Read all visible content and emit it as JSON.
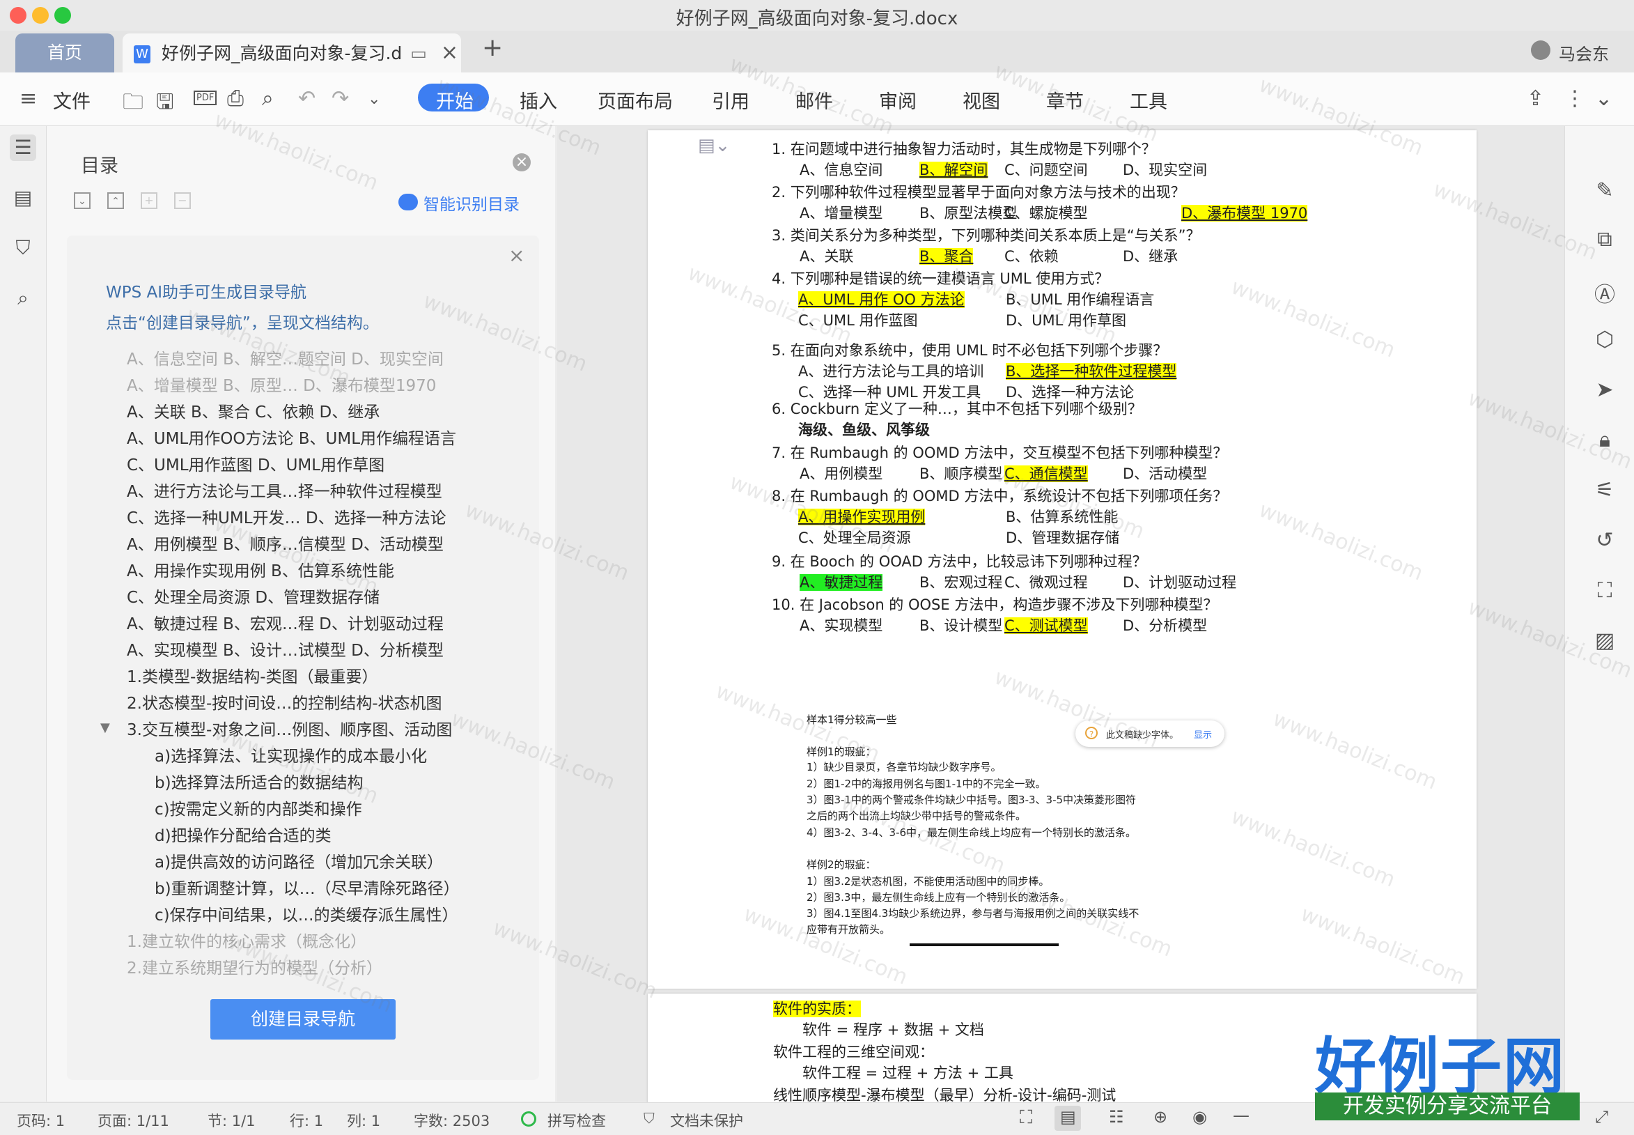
{
  "window": {
    "title": "好例子网_高级面向对象-复习.docx"
  },
  "tabs": {
    "home": "首页",
    "doc": "好例子网_高级面向对象-复习.d",
    "add": "+",
    "user": "马会东"
  },
  "ribbon": {
    "file": "文件",
    "menus": [
      "开始",
      "插入",
      "页面布局",
      "引用",
      "邮件",
      "审阅",
      "视图",
      "章节",
      "工具"
    ]
  },
  "toc": {
    "title": "目录",
    "smart": "智能识别目录",
    "ai_line1": "WPS AI助手可生成目录导航",
    "ai_line2": "点击“创建目录导航”，呈现文档结构。",
    "items": [
      {
        "text": "A、信息空间  B、解空…题空间  D、现实空间",
        "dim": true,
        "indent": 0
      },
      {
        "text": "A、增量模型  B、原型… D、瀑布模型1970",
        "dim": true,
        "indent": 0
      },
      {
        "text": "A、关联  B、聚合  C、依赖  D、继承",
        "dim": false,
        "indent": 0
      },
      {
        "text": "A、UML用作OO方法论  B、UML用作编程语言",
        "dim": false,
        "indent": 0
      },
      {
        "text": "C、UML用作蓝图    D、UML用作草图",
        "dim": false,
        "indent": 0
      },
      {
        "text": "A、进行方法论与工具…择一种软件过程模型",
        "dim": false,
        "indent": 0
      },
      {
        "text": "C、选择一种UML开发… D、选择一种方法论",
        "dim": false,
        "indent": 0
      },
      {
        "text": "A、用例模型  B、顺序…信模型  D、活动模型",
        "dim": false,
        "indent": 0
      },
      {
        "text": "A、用操作实现用例   B、估算系统性能",
        "dim": false,
        "indent": 0
      },
      {
        "text": "C、处理全局资源    D、管理数据存储",
        "dim": false,
        "indent": 0
      },
      {
        "text": "A、敏捷过程  B、宏观…程  D、计划驱动过程",
        "dim": false,
        "indent": 0
      },
      {
        "text": "A、实现模型  B、设计…试模型  D、分析模型",
        "dim": false,
        "indent": 0
      },
      {
        "text": "1.类模型-数据结构-类图（最重要）",
        "dim": false,
        "indent": 0
      },
      {
        "text": "2.状态模型-按时间设…的控制结构-状态机图",
        "dim": false,
        "indent": 0
      },
      {
        "text": "3.交互模型-对象之间…例图、顺序图、活动图",
        "dim": false,
        "indent": 0
      },
      {
        "text": "a)选择算法、让实现操作的成本最小化",
        "dim": false,
        "indent": 1
      },
      {
        "text": "b)选择算法所适合的数据结构",
        "dim": false,
        "indent": 1
      },
      {
        "text": "c)按需定义新的内部类和操作",
        "dim": false,
        "indent": 1
      },
      {
        "text": "d)把操作分配给合适的类",
        "dim": false,
        "indent": 1
      },
      {
        "text": "a)提供高效的访问路径（增加冗余关联）",
        "dim": false,
        "indent": 1
      },
      {
        "text": "b)重新调整计算，以…（尽早清除死路径）",
        "dim": false,
        "indent": 1
      },
      {
        "text": "c)保存中间结果，以…的类缓存派生属性）",
        "dim": false,
        "indent": 1
      },
      {
        "text": "1.建立软件的核心需求（概念化）",
        "dim": true,
        "indent": 0
      },
      {
        "text": "2.建立系统期望行为的模型（分析）",
        "dim": true,
        "indent": 0
      }
    ],
    "create_button": "创建目录导航"
  },
  "doc": {
    "questions": [
      {
        "q": "1.   在问题域中进行抽象智力活动时，其生成物是下列哪个？",
        "opts": [
          [
            "A、信息空间",
            ""
          ],
          [
            "B、解空间",
            "y"
          ],
          [
            "C、问题空间",
            ""
          ],
          [
            "D、现实空间",
            ""
          ]
        ]
      },
      {
        "q": "2.   下列哪种软件过程模型显著早于面向对象方法与技术的出现？",
        "opts": [
          [
            "A、增量模型",
            ""
          ],
          [
            "B、原型法模型",
            ""
          ],
          [
            "C、螺旋模型",
            ""
          ],
          [
            "D、瀑布模型 1970",
            "y"
          ]
        ]
      },
      {
        "q": "3.   类间关系分为多种类型，下列哪种类间关系本质上是“与关系”？",
        "opts": [
          [
            "A、关联",
            ""
          ],
          [
            "B、聚合",
            "y"
          ],
          [
            "C、依赖",
            ""
          ],
          [
            "D、继承",
            ""
          ]
        ]
      },
      {
        "q": "4.   下列哪种是错误的统一建模语言 UML 使用方式？",
        "opts": [
          [
            "A、UML 用作 OO 方法论",
            "y"
          ],
          [
            "B、UML 用作编程语言",
            ""
          ],
          [
            "C、UML 用作蓝图",
            ""
          ],
          [
            "D、UML 用作草图",
            ""
          ]
        ]
      },
      {
        "q": "5.   在面向对象系统中，使用 UML 时不必包括下列哪个步骤？",
        "opts": [
          [
            "A、进行方法论与工具的培训",
            ""
          ],
          [
            "B、选择一种软件过程模型",
            "y"
          ],
          [
            "C、选择一种 UML 开发工具",
            ""
          ],
          [
            "D、选择一种方法论",
            ""
          ]
        ]
      },
      {
        "q": "6.   Cockburn 定义了一种…，其中不包括下列哪个级别？",
        "opts": [
          [
            "海级、鱼级、风筝级",
            "b"
          ]
        ]
      },
      {
        "q": "7.   在 Rumbaugh 的 OOMD 方法中，交互模型不包括下列哪种模型？",
        "opts": [
          [
            "A、用例模型",
            ""
          ],
          [
            "B、顺序模型",
            ""
          ],
          [
            "C、通信模型",
            "y"
          ],
          [
            "D、活动模型",
            ""
          ]
        ]
      },
      {
        "q": "8.   在 Rumbaugh 的 OOMD 方法中，系统设计不包括下列哪项任务？",
        "opts": [
          [
            "A、用操作实现用例",
            "y"
          ],
          [
            "B、估算系统性能",
            ""
          ],
          [
            "C、处理全局资源",
            ""
          ],
          [
            "D、管理数据存储",
            ""
          ]
        ]
      },
      {
        "q": "9.   在 Booch 的 OOAD 方法中，比较忌讳下列哪种过程？",
        "opts": [
          [
            "A、敏捷过程",
            "g"
          ],
          [
            "B、宏观过程",
            ""
          ],
          [
            "C、微观过程",
            ""
          ],
          [
            "D、计划驱动过程",
            ""
          ]
        ]
      },
      {
        "q": "10.  在 Jacobson 的 OOSE 方法中，构造步骤不涉及下列哪种模型？",
        "opts": [
          [
            "A、实现模型",
            ""
          ],
          [
            "B、设计模型",
            ""
          ],
          [
            "C、测试模型",
            "y"
          ],
          [
            "D、分析模型",
            ""
          ]
        ]
      }
    ],
    "sample_title": "样本1得分较高一些",
    "font_warning": "此文稿缺少字体。",
    "font_show": "显示",
    "sample1_head": "样例1的瑕疵：",
    "sample1": [
      "1）缺少目录页，各章节均缺少数字序号。",
      "2）图1-2中的海报用例名与图1-1中的不完全一致。",
      "3）图3-1中的两个警戒条件均缺少中括号。图3-3、3-5中决策菱形图符",
      "之后的两个出流上均缺少带中括号的警戒条件。",
      "4）图3-2、3-4、3-6中，最左侧生命线上均应有一个特别长的激活条。"
    ],
    "sample2_head": "样例2的瑕疵：",
    "sample2": [
      "1）图3.2是状态机图，不能使用活动图中的同步棒。",
      "2）图3.3中，最左侧生命线上应有一个特别长的激活条。",
      "3）图4.1至图4.3均缺少系统边界，参与者与海报用例之间的关联实线不",
      "应带有开放箭头。"
    ],
    "page2": {
      "line1": "软件的实质：",
      "line2": "软件 = 程序 + 数据 + 文档",
      "line3": "软件工程的三维空间观：",
      "line4": "软件工程 = 过程 + 方法 + 工具",
      "line5": "线性顺序模型-瀑布模型（最早）分析-设计-编码-测试"
    }
  },
  "status": {
    "page_code": "页码: 1",
    "page": "页面: 1/11",
    "section": "节: 1/1",
    "row": "行: 1",
    "col": "列: 1",
    "words": "字数: 2503",
    "spell": "拼写检查",
    "protect": "文档未保护"
  },
  "watermark": {
    "logo": "好例子网",
    "slogan": "开发实例分享交流平台",
    "url": "www.haolizi.com"
  },
  "colors": {
    "accent": "#3d7ef2",
    "highlight_yellow": "#ffff00",
    "highlight_green": "#22ee22"
  }
}
